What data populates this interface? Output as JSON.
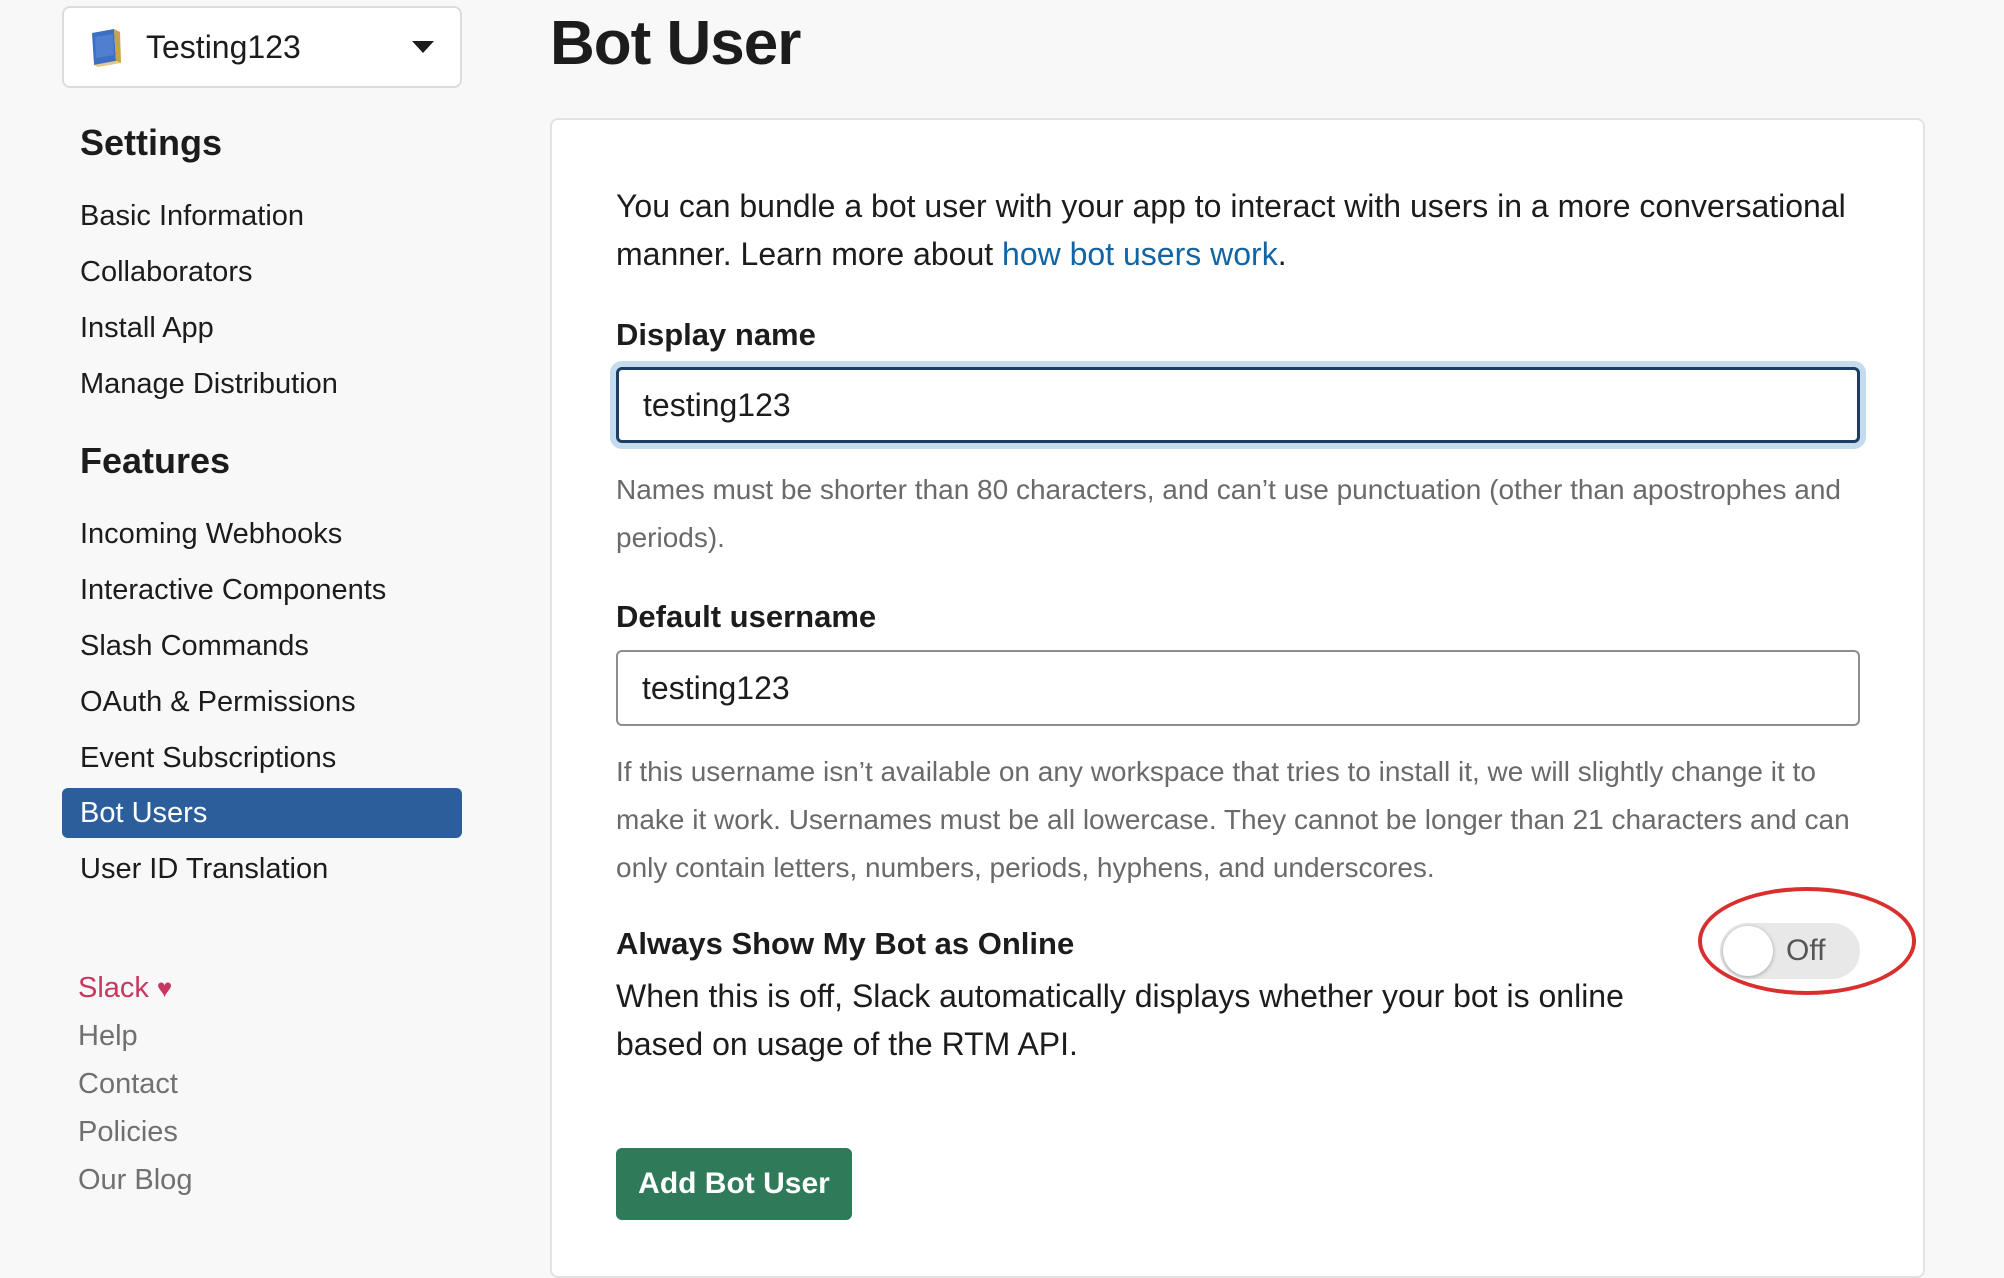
{
  "app_switcher": {
    "name": "Testing123",
    "icon": "app-book-icon"
  },
  "sidebar": {
    "settings_heading": "Settings",
    "settings_items": [
      {
        "label": "Basic Information"
      },
      {
        "label": "Collaborators"
      },
      {
        "label": "Install App"
      },
      {
        "label": "Manage Distribution"
      }
    ],
    "features_heading": "Features",
    "features_items": [
      {
        "label": "Incoming Webhooks"
      },
      {
        "label": "Interactive Components"
      },
      {
        "label": "Slash Commands"
      },
      {
        "label": "OAuth & Permissions"
      },
      {
        "label": "Event Subscriptions"
      },
      {
        "label": "Bot Users",
        "active": true
      },
      {
        "label": "User ID Translation"
      }
    ],
    "footer": {
      "slack": "Slack",
      "heart": "♥",
      "help": "Help",
      "contact": "Contact",
      "policies": "Policies",
      "blog": "Our Blog"
    }
  },
  "main": {
    "title": "Bot User",
    "intro_text": "You can bundle a bot user with your app to interact with users in a more conversational manner. Learn more about ",
    "intro_link": "how bot users work",
    "intro_end": ".",
    "display_name": {
      "label": "Display name",
      "value": "testing123",
      "help": "Names must be shorter than 80 characters, and can’t use punctuation (other than apostrophes and periods)."
    },
    "default_username": {
      "label": "Default username",
      "value": "testing123",
      "help": "If this username isn’t available on any workspace that tries to install it, we will slightly change it to make it work. Usernames must be all lowercase. They cannot be longer than 21 characters and can only contain letters, numbers, periods, hyphens, and underscores."
    },
    "online_toggle": {
      "title": "Always Show My Bot as Online",
      "description": "When this is off, Slack automatically displays whether your bot is online based on usage of the RTM API.",
      "state_label": "Off",
      "on": false
    },
    "add_button": "Add Bot User"
  },
  "colors": {
    "active_nav": "#2c5e9c",
    "link": "#1264a3",
    "primary_button": "#2f7a59",
    "slack_brand": "#c83760",
    "annotation": "#d9302f"
  }
}
